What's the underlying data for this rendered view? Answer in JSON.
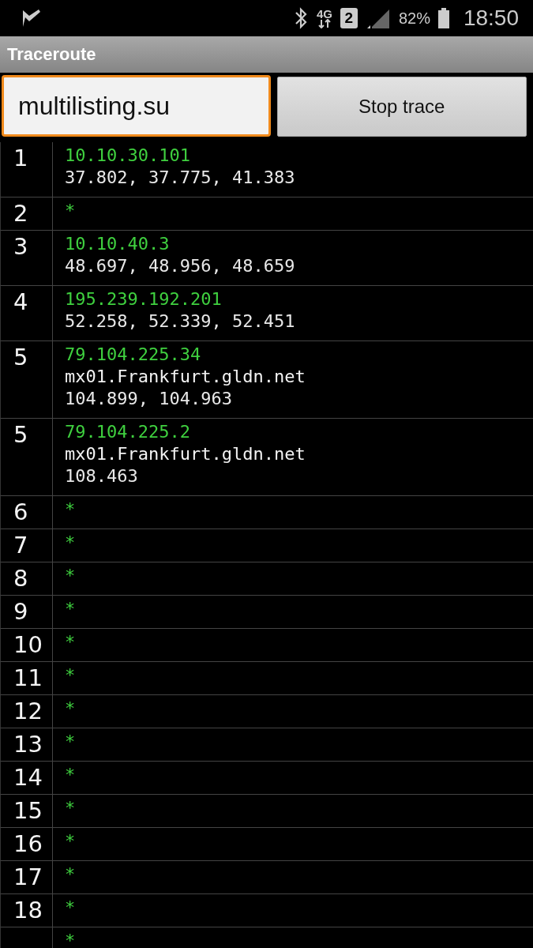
{
  "status_bar": {
    "network": "4G",
    "sim": "2",
    "battery_percent": "82%",
    "time": "18:50"
  },
  "window": {
    "title": "Traceroute"
  },
  "host_field": {
    "value": "multilisting.su",
    "focused": true
  },
  "stop_button": {
    "label": "Stop trace"
  },
  "hops": [
    {
      "hop": "1",
      "lines": [
        {
          "kind": "address",
          "text": "10.10.30.101"
        },
        {
          "kind": "times",
          "text": "37.802, 37.775, 41.383"
        }
      ]
    },
    {
      "hop": "2",
      "lines": [
        {
          "kind": "address",
          "text": "*"
        }
      ]
    },
    {
      "hop": "3",
      "lines": [
        {
          "kind": "address",
          "text": "10.10.40.3"
        },
        {
          "kind": "times",
          "text": "48.697, 48.956, 48.659"
        }
      ]
    },
    {
      "hop": "4",
      "lines": [
        {
          "kind": "address",
          "text": "195.239.192.201"
        },
        {
          "kind": "times",
          "text": "52.258, 52.339, 52.451"
        }
      ]
    },
    {
      "hop": "5",
      "lines": [
        {
          "kind": "address",
          "text": "79.104.225.34"
        },
        {
          "kind": "host",
          "text": "mx01.Frankfurt.gldn.net"
        },
        {
          "kind": "times",
          "text": "104.899, 104.963"
        }
      ]
    },
    {
      "hop": "5",
      "lines": [
        {
          "kind": "address",
          "text": "79.104.225.2"
        },
        {
          "kind": "host",
          "text": "mx01.Frankfurt.gldn.net"
        },
        {
          "kind": "times",
          "text": "108.463"
        }
      ]
    },
    {
      "hop": "6",
      "lines": [
        {
          "kind": "address",
          "text": "*"
        }
      ]
    },
    {
      "hop": "7",
      "lines": [
        {
          "kind": "address",
          "text": "*"
        }
      ]
    },
    {
      "hop": "8",
      "lines": [
        {
          "kind": "address",
          "text": "*"
        }
      ]
    },
    {
      "hop": "9",
      "lines": [
        {
          "kind": "address",
          "text": "*"
        }
      ]
    },
    {
      "hop": "10",
      "lines": [
        {
          "kind": "address",
          "text": "*"
        }
      ]
    },
    {
      "hop": "11",
      "lines": [
        {
          "kind": "address",
          "text": "*"
        }
      ]
    },
    {
      "hop": "12",
      "lines": [
        {
          "kind": "address",
          "text": "*"
        }
      ]
    },
    {
      "hop": "13",
      "lines": [
        {
          "kind": "address",
          "text": "*"
        }
      ]
    },
    {
      "hop": "14",
      "lines": [
        {
          "kind": "address",
          "text": "*"
        }
      ]
    },
    {
      "hop": "15",
      "lines": [
        {
          "kind": "address",
          "text": "*"
        }
      ]
    },
    {
      "hop": "16",
      "lines": [
        {
          "kind": "address",
          "text": "*"
        }
      ]
    },
    {
      "hop": "17",
      "lines": [
        {
          "kind": "address",
          "text": "*"
        }
      ]
    },
    {
      "hop": "18",
      "lines": [
        {
          "kind": "address",
          "text": "*"
        }
      ]
    },
    {
      "lines": [
        {
          "kind": "address",
          "text": "*"
        }
      ]
    }
  ]
}
